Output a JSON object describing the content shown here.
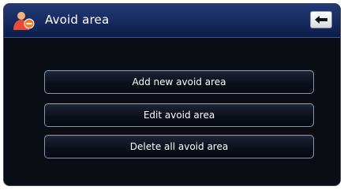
{
  "header": {
    "title": "Avoid area",
    "icon": "avoid-area-person-icon",
    "back_icon": "back-arrow-icon"
  },
  "menu": {
    "items": [
      {
        "label": "Add new avoid area"
      },
      {
        "label": "Edit avoid area"
      },
      {
        "label": "Delete all avoid area"
      }
    ]
  },
  "colors": {
    "header_top": "#233a77",
    "header_bottom": "#0d1d47",
    "background": "#0a0d14",
    "button_border": "#8b93a8",
    "text": "#ffffff"
  }
}
